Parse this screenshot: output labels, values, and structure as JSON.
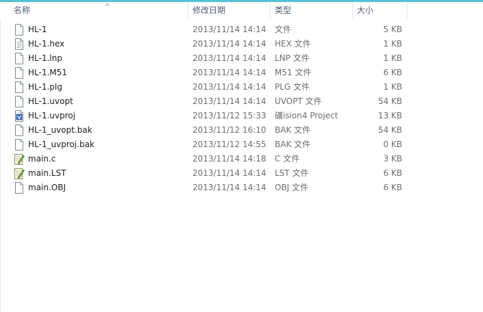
{
  "columns": {
    "name": "名称",
    "date": "修改日期",
    "type": "类型",
    "size": "大小"
  },
  "files": [
    {
      "name": "HL-1",
      "date": "2013/11/14 14:14",
      "type": "文件",
      "size": "5 KB",
      "icon": "document-icon"
    },
    {
      "name": "HL-1.hex",
      "date": "2013/11/14 14:14",
      "type": "HEX 文件",
      "size": "1 KB",
      "icon": "hex-file-icon"
    },
    {
      "name": "HL-1.lnp",
      "date": "2013/11/14 14:14",
      "type": "LNP 文件",
      "size": "1 KB",
      "icon": "document-icon"
    },
    {
      "name": "HL-1.M51",
      "date": "2013/11/14 14:14",
      "type": "M51 文件",
      "size": "6 KB",
      "icon": "document-icon"
    },
    {
      "name": "HL-1.plg",
      "date": "2013/11/14 14:14",
      "type": "PLG 文件",
      "size": "1 KB",
      "icon": "document-icon"
    },
    {
      "name": "HL-1.uvopt",
      "date": "2013/11/14 14:14",
      "type": "UVOPT 文件",
      "size": "54 KB",
      "icon": "document-icon"
    },
    {
      "name": "HL-1.uvproj",
      "date": "2013/11/12 15:33",
      "type": "礦ision4 Project",
      "size": "13 KB",
      "icon": "uvision-project-icon"
    },
    {
      "name": "HL-1_uvopt.bak",
      "date": "2013/11/12 16:10",
      "type": "BAK 文件",
      "size": "54 KB",
      "icon": "document-icon"
    },
    {
      "name": "HL-1_uvproj.bak",
      "date": "2013/11/12 14:55",
      "type": "BAK 文件",
      "size": "0 KB",
      "icon": "document-icon"
    },
    {
      "name": "main.c",
      "date": "2013/11/14 14:18",
      "type": "C 文件",
      "size": "3 KB",
      "icon": "edit-file-icon"
    },
    {
      "name": "main.LST",
      "date": "2013/11/14 14:14",
      "type": "LST 文件",
      "size": "6 KB",
      "icon": "edit-file-icon"
    },
    {
      "name": "main.OBJ",
      "date": "2013/11/14 14:14",
      "type": "OBJ 文件",
      "size": "6 KB",
      "icon": "document-icon"
    }
  ]
}
